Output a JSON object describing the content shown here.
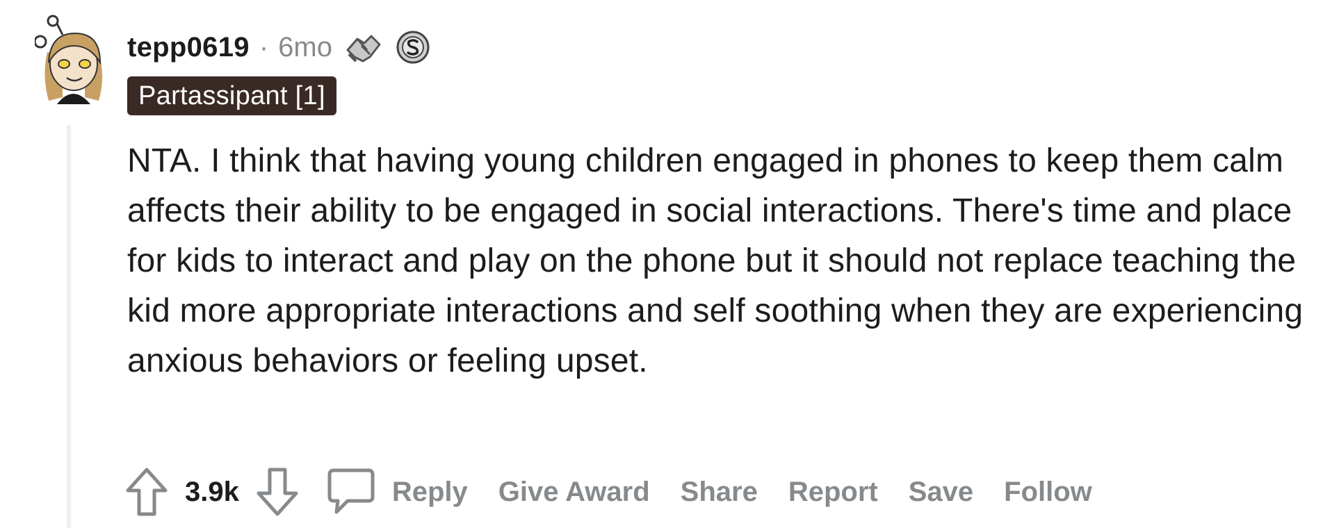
{
  "comment": {
    "username": "tepp0619",
    "separator": "·",
    "time_ago": "6mo",
    "awards": [
      {
        "icon": "handshake-award-icon"
      },
      {
        "icon": "silver-coin-award-icon"
      }
    ],
    "flair": "Partassipant [1]",
    "body": "NTA. I think that having young children engaged in phones to keep them calm affects their ability to be engaged in social interactions. There's time and place for kids to interact and play on the phone but it should not replace teaching the kid more appropriate interactions and self soothing when they are experiencing anxious behaviors or feeling upset."
  },
  "actions": {
    "score": "3.9k",
    "reply": "Reply",
    "give_award": "Give Award",
    "share": "Share",
    "report": "Report",
    "save": "Save",
    "follow": "Follow"
  },
  "colors": {
    "flair_bg": "#3a2a25",
    "muted": "#878a8c",
    "text": "#1c1c1c"
  }
}
